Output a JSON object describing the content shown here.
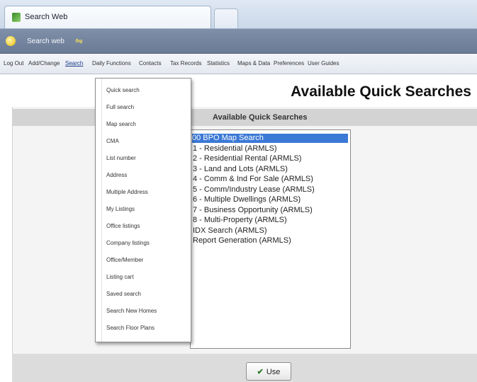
{
  "browser": {
    "tab_title": "Search Web",
    "favorites_label": "Search web"
  },
  "menu": {
    "items": [
      "Log Out",
      "Add/Change",
      "Search",
      "Daily Functions",
      "Contacts",
      "Tax Records",
      "Statistics",
      "Maps & Data",
      "Preferences",
      "User Guides"
    ],
    "active": "Search"
  },
  "search_menu": {
    "items": [
      "Quick search",
      "Full search",
      "Map search",
      "CMA",
      "List number",
      "Address",
      "Multiple Address",
      "My Listings",
      "Office listings",
      "Company listings",
      "Office/Member",
      "Listing cart",
      "Saved search",
      "Search New Homes",
      "Search Floor Plans"
    ]
  },
  "page": {
    "heading": "Available Quick Searches",
    "panel_header": "Available Quick Searches",
    "use_button": "Use"
  },
  "quick_searches": {
    "items": [
      "00 BPO Map Search",
      "1 - Residential (ARMLS)",
      "2 - Residential Rental (ARMLS)",
      "3 - Land and Lots (ARMLS)",
      "4 - Comm & Ind For Sale (ARMLS)",
      "5 - Comm/Industry Lease (ARMLS)",
      "6 - Multiple Dwellings (ARMLS)",
      "7 - Business Opportunity (ARMLS)",
      "8 - Multi-Property (ARMLS)",
      "IDX Search (ARMLS)",
      "Report Generation (ARMLS)"
    ],
    "selected_index": 0
  },
  "colors": {
    "selection": "#3b79d6",
    "favorites_bar": "#6a7b96"
  }
}
